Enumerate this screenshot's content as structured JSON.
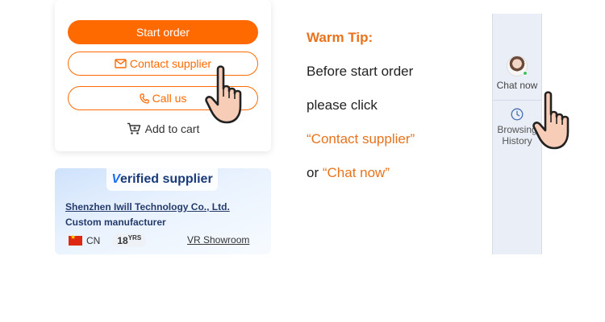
{
  "order_card": {
    "start_order_label": "Start order",
    "contact_supplier_label": "Contact supplier",
    "call_us_label": "Call us",
    "add_to_cart_label": "Add to cart"
  },
  "supplier_card": {
    "badge_prefix": "V",
    "badge_rest": "erified supplier",
    "company_name": "Shenzhen Iwill Technology Co., Ltd.",
    "company_type": "Custom manufacturer",
    "country": "CN",
    "years_value": "18",
    "years_unit": "YRS",
    "vr_showroom_label": "VR Showroom"
  },
  "tip": {
    "title": "Warm Tip:",
    "line1": "Before start order",
    "line2": "please click",
    "line3": "“Contact supplier”",
    "line4_prefix": "or ",
    "line4_highlight": "“Chat now”"
  },
  "sidebar": {
    "chat_now_label": "Chat now",
    "browsing_line1": "Browsing",
    "browsing_line2": "History"
  },
  "colors": {
    "accent": "#ff6a00",
    "tip_orange": "#e8731c",
    "sidebar_bg": "#e9eef7"
  },
  "icons": [
    "envelope-icon",
    "phone-icon",
    "cart-icon",
    "clock-icon",
    "hand-pointer-icon",
    "china-flag-icon"
  ]
}
